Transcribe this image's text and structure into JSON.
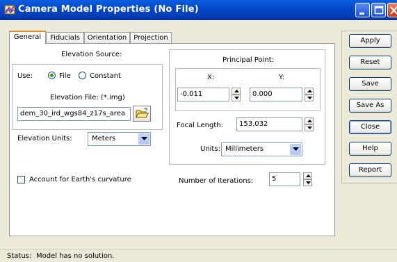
{
  "window": {
    "title": "Camera Model Properties (No File)"
  },
  "tabs": [
    {
      "label": "General",
      "active": true
    },
    {
      "label": "Fiducials",
      "active": false
    },
    {
      "label": "Orientation",
      "active": false
    },
    {
      "label": "Projection",
      "active": false
    }
  ],
  "elevation": {
    "source_label": "Elevation Source:",
    "use_label": "Use:",
    "option_file": "File",
    "option_constant": "Constant",
    "selected": "File",
    "file_label": "Elevation File: (*.img)",
    "file_value": "dem_30_ird_wgs84_z17s_area",
    "units_label": "Elevation Units:",
    "units_value": "Meters"
  },
  "principal_point": {
    "title": "Principal Point:",
    "x_label": "X:",
    "y_label": "Y:",
    "x_value": "-0.011",
    "y_value": "0.000"
  },
  "focal": {
    "label": "Focal Length:",
    "value": "153.032",
    "units_label": "Units:",
    "units_value": "Millimeters"
  },
  "curvature": {
    "label": "Account for Earth's curvature",
    "checked": false
  },
  "iterations": {
    "label": "Number of Iterations:",
    "value": "5"
  },
  "buttons": {
    "apply": "Apply",
    "reset": "Reset",
    "save": "Save",
    "save_as": "Save As",
    "close": "Close",
    "help": "Help",
    "report": "Report"
  },
  "status": {
    "label": "Status:",
    "text": "Model has no solution."
  },
  "icons": {
    "app": "camera-model-icon",
    "browse": "folder-open-icon"
  },
  "colors": {
    "title_bar": "#0446c6",
    "dialog_bg": "#ece9d8",
    "tab_accent": "#e68b2c",
    "close_button": "#c33b12"
  }
}
